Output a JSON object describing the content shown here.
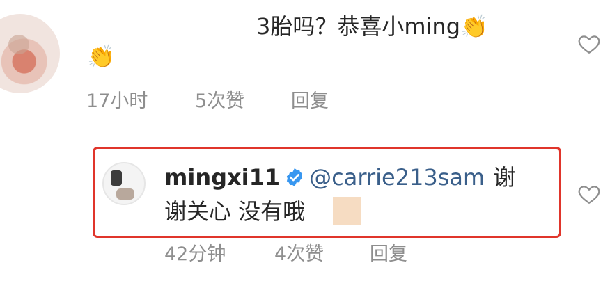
{
  "comment": {
    "text": "3胎吗？恭喜小ming",
    "clap_emoji_1": "👏",
    "clap_emoji_2": "👏",
    "time": "17小时",
    "likes": "5次赞",
    "reply_label": "回复"
  },
  "reply": {
    "username": "mingxi11",
    "mention": "@carrie213sam",
    "text_line1_end": "谢",
    "text_line2": "谢关心 没有哦",
    "time": "42分钟",
    "likes": "4次赞",
    "reply_label": "回复"
  },
  "colors": {
    "highlight_border": "#e0352b",
    "verified_blue": "#3897f0",
    "mention_blue": "#3a5f8a",
    "meta_gray": "#8e8e8e"
  },
  "icons": {
    "like": "heart-outline-icon",
    "verified": "verified-badge-icon"
  }
}
